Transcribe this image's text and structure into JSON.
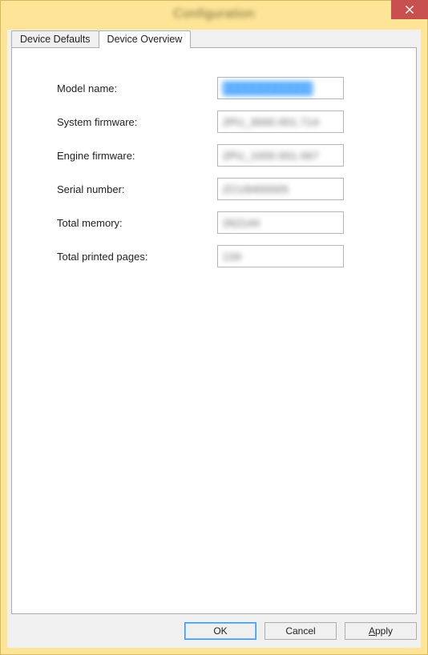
{
  "title": "Configuration",
  "tabs": {
    "defaults": "Device Defaults",
    "overview": "Device Overview"
  },
  "labels": {
    "model": "Model name:",
    "sysfw": "System firmware:",
    "engfw": "Engine firmware:",
    "serial": "Serial number:",
    "memory": "Total memory:",
    "pages": "Total printed pages:"
  },
  "values": {
    "model": "XXXXXXXXXXXX",
    "sysfw": "2PU_3000.001.714",
    "engfw": "2PU_1000.001.067",
    "serial": "ZCU9400005",
    "memory": "262144",
    "pages": "134"
  },
  "buttons": {
    "ok": "OK",
    "cancel": "Cancel",
    "apply": "Apply"
  }
}
